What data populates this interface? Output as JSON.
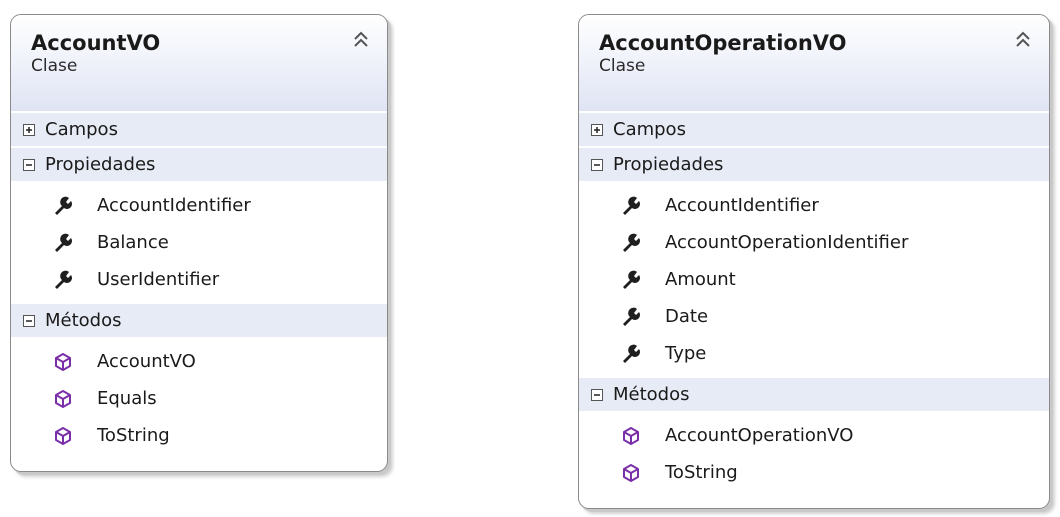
{
  "classes": [
    {
      "name": "AccountVO",
      "kind": "Clase",
      "sections": [
        {
          "label": "Campos",
          "state": "collapsed",
          "members": []
        },
        {
          "label": "Propiedades",
          "state": "expanded",
          "icon": "wrench-icon",
          "members": [
            "AccountIdentifier",
            "Balance",
            "UserIdentifier"
          ]
        },
        {
          "label": "Métodos",
          "state": "expanded",
          "icon": "method-cube-icon",
          "members": [
            "AccountVO",
            "Equals",
            "ToString"
          ]
        }
      ]
    },
    {
      "name": "AccountOperationVO",
      "kind": "Clase",
      "sections": [
        {
          "label": "Campos",
          "state": "collapsed",
          "members": []
        },
        {
          "label": "Propiedades",
          "state": "expanded",
          "icon": "wrench-icon",
          "members": [
            "AccountIdentifier",
            "AccountOperationIdentifier",
            "Amount",
            "Date",
            "Type"
          ]
        },
        {
          "label": "Métodos",
          "state": "expanded",
          "icon": "method-cube-icon",
          "members": [
            "AccountOperationVO",
            "ToString"
          ]
        }
      ]
    }
  ],
  "colors": {
    "header_gradient_end": "#dfe4f4",
    "section_band": "#e7ebf6",
    "property_icon": "#1f1f1f",
    "method_icon": "#7a2fa8",
    "border": "#8a8a8a"
  }
}
